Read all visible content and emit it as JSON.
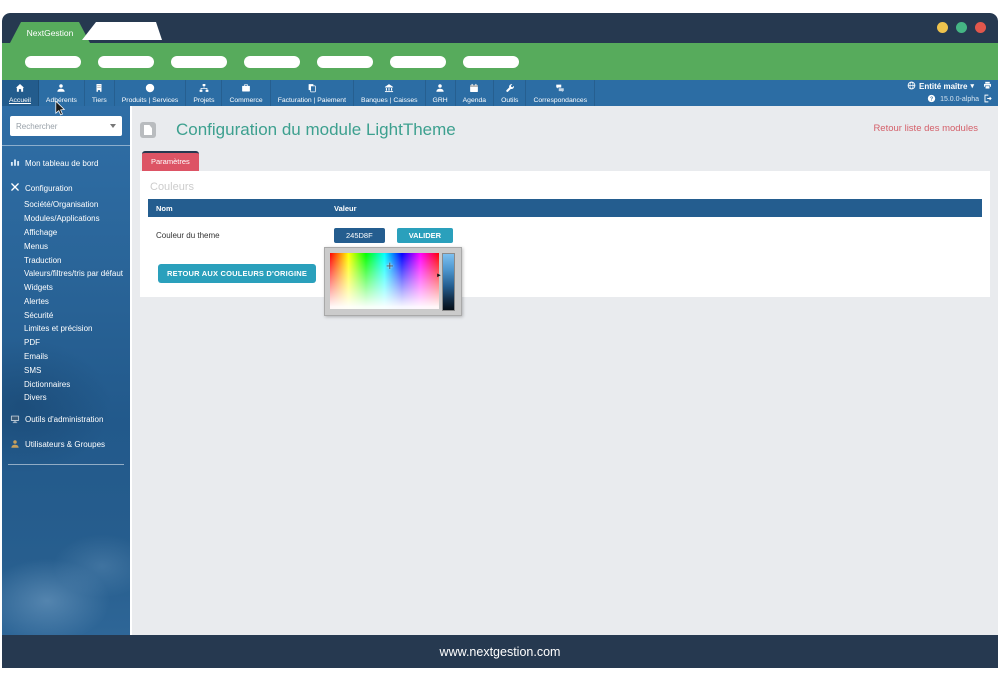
{
  "window": {
    "tab_title": "NextGestion",
    "control_colors": [
      "#eec34d",
      "#45b684",
      "#e2574c"
    ]
  },
  "navbar": {
    "items": [
      {
        "label": "Accueil",
        "icon": "home-icon",
        "active": true
      },
      {
        "label": "Adhérents",
        "icon": "member-icon"
      },
      {
        "label": "Tiers",
        "icon": "third-parties-icon"
      },
      {
        "label": "Produits | Services",
        "icon": "products-services-icon"
      },
      {
        "label": "Projets",
        "icon": "projects-icon"
      },
      {
        "label": "Commerce",
        "icon": "commerce-icon"
      },
      {
        "label": "Facturation | Paiement",
        "icon": "billing-icon"
      },
      {
        "label": "Banques | Caisses",
        "icon": "bank-icon"
      },
      {
        "label": "GRH",
        "icon": "hr-icon"
      },
      {
        "label": "Agenda",
        "icon": "calendar-icon"
      },
      {
        "label": "Outils",
        "icon": "wrench-icon"
      },
      {
        "label": "Correspondances",
        "icon": "correspondence-icon"
      }
    ],
    "entity_label": "Entité maître",
    "version": "15.0.0-alpha"
  },
  "sidebar": {
    "search_placeholder": "Rechercher",
    "dashboard": {
      "label": "Mon tableau de bord",
      "icon": "bar-chart-icon"
    },
    "configuration": {
      "label": "Configuration",
      "icon": "tools-icon"
    },
    "config_children": [
      "Société/Organisation",
      "Modules/Applications",
      "Affichage",
      "Menus",
      "Traduction",
      "Valeurs/filtres/tris par défaut",
      "Widgets",
      "Alertes",
      "Sécurité",
      "Limites et précision",
      "PDF",
      "Emails",
      "SMS",
      "Dictionnaires",
      "Divers"
    ],
    "admin": {
      "label": "Outils d'administration",
      "icon": "terminal-icon"
    },
    "users": {
      "label": "Utilisateurs & Groupes",
      "icon": "users-icon"
    }
  },
  "main": {
    "title": "Configuration du module LightTheme",
    "back_link": "Retour liste des modules",
    "tab_label": "Paramètres",
    "section_title": "Couleurs",
    "table_headers": {
      "name": "Nom",
      "value": "Valeur"
    },
    "row_name": "Couleur du theme",
    "color_value": "245D8F",
    "validate_button": "VALIDER",
    "reset_button": "RETOUR AUX COULEURS D'ORIGINE"
  },
  "footer": {
    "url": "www.nextgestion.com"
  },
  "colors": {
    "theme_color": "#245D8F",
    "nav_blue": "#2c6da4",
    "header_navy": "#263950",
    "toolbar_green": "#57ab5c",
    "accent_teal": "#2aa0bc",
    "tab_red": "#dd5465",
    "title_teal": "#3da08f",
    "link_red": "#d4606a"
  }
}
